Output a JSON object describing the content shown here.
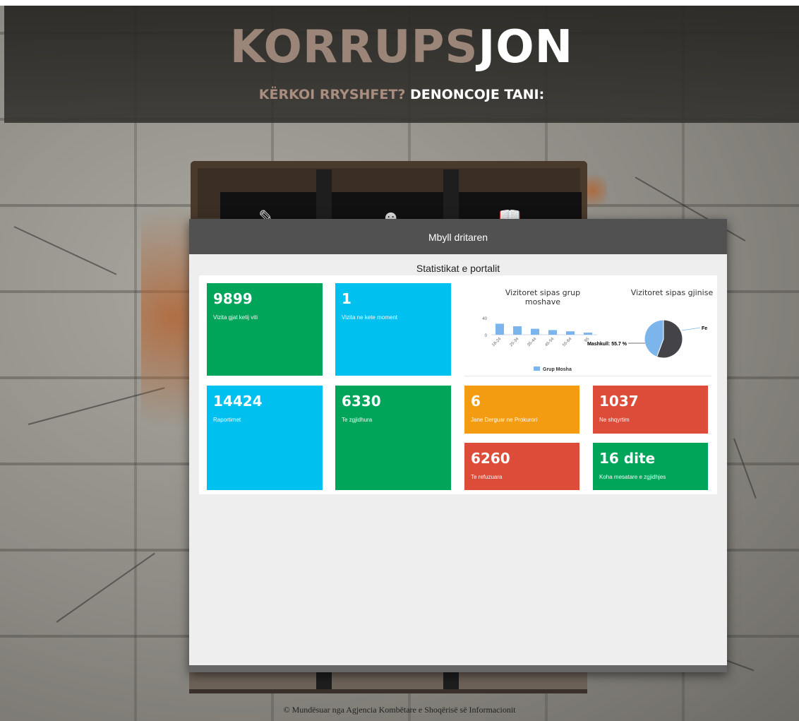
{
  "header": {
    "logo_part1": "KORRUPS",
    "logo_part2": "JON",
    "tagline_part1": "KËRKOI RRYSHFET?",
    "tagline_part2": "DENONCOJE TANI:"
  },
  "modal": {
    "close_label": "Mbyll dritaren",
    "title": "Statistikat e portalit"
  },
  "tiles": [
    {
      "value": "9899",
      "label": "Vizita gjat ketij viti",
      "color": "#00a55a"
    },
    {
      "value": "1",
      "label": "Vizita ne kete moment",
      "color": "#00c0ef"
    },
    {
      "value": "14424",
      "label": "Raportimet",
      "color": "#00c0ef"
    },
    {
      "value": "6330",
      "label": "Te zgjidhura",
      "color": "#00a55a"
    },
    {
      "value": "6",
      "label": "Jane Derguar ne Prokurori",
      "color": "#f39c12"
    },
    {
      "value": "1037",
      "label": "Ne shqyrtim",
      "color": "#dd4b39"
    },
    {
      "value": "6260",
      "label": "Te refuzuara",
      "color": "#dd4b39"
    },
    {
      "value": "16 dite",
      "label": "Koha mesatare e zgjidhjes",
      "color": "#00a55a"
    }
  ],
  "chart_data": [
    {
      "type": "bar",
      "title": "Vizitoret sipas grup moshave",
      "categories": [
        "18-24",
        "25-34",
        "35-44",
        "45-54",
        "55-64",
        "65"
      ],
      "series": [
        {
          "name": "Grup Mosha",
          "values": [
            26,
            20,
            14,
            11,
            8,
            5
          ]
        }
      ],
      "ylim": [
        0,
        40
      ],
      "yticks": [
        "0",
        "40"
      ],
      "ylabel": "",
      "legend": "bottom",
      "colors": [
        "#7cb5ec"
      ]
    },
    {
      "type": "pie",
      "title": "Vizitoret sipas gjinise",
      "slices": [
        {
          "label": "Mashkull: 55.7 %",
          "value": 55.7,
          "color": "#434348"
        },
        {
          "label": "Fe",
          "value": 44.3,
          "color": "#7cb5ec"
        }
      ]
    }
  ],
  "footer": {
    "text": "© Mundësuar nga Agjencia Kombëtare e Shoqërisë së Informacionit"
  }
}
